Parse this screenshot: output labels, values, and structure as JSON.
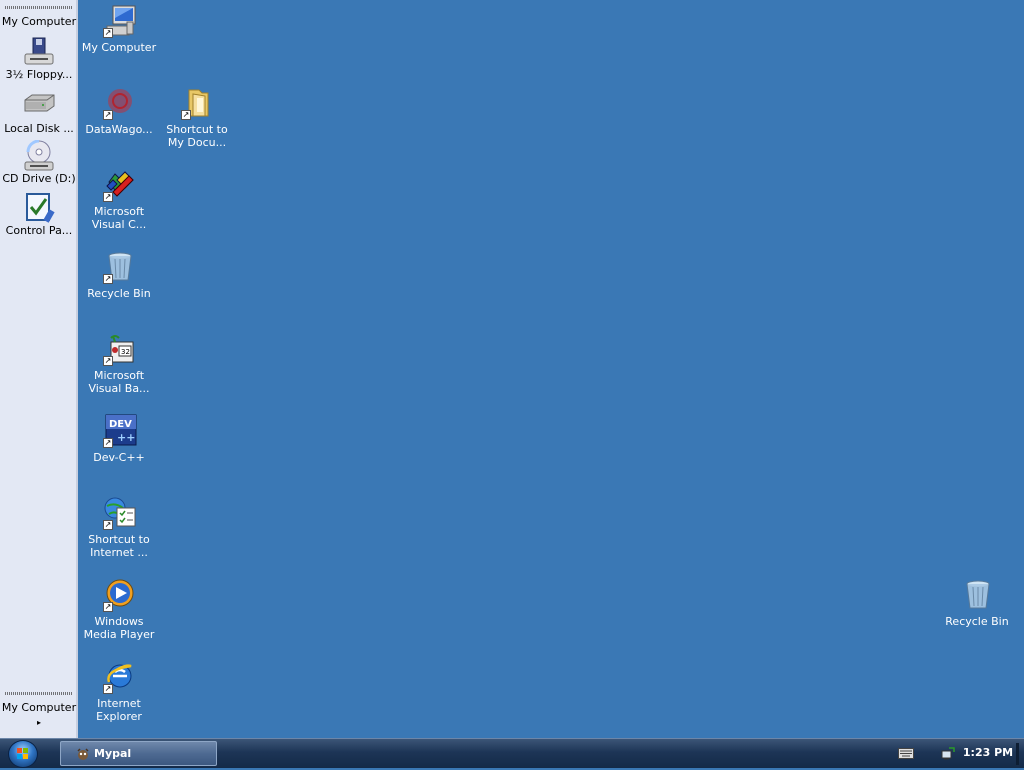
{
  "sidebar": {
    "title": "My Computer",
    "items": [
      {
        "label": "3½ Floppy...",
        "icon": "floppy-drive-icon"
      },
      {
        "label": "Local Disk ...",
        "icon": "hard-disk-icon"
      },
      {
        "label": "CD Drive (D:)",
        "icon": "cd-drive-icon"
      },
      {
        "label": "Control Pa...",
        "icon": "control-panel-icon"
      }
    ],
    "bottom_label": "My Computer",
    "bottom_chevron": "▸"
  },
  "desktop_icons": [
    {
      "label": "My Computer",
      "icon": "my-computer-icon",
      "shortcut": true
    },
    {
      "label": "DataWago...",
      "icon": "datawagon-icon",
      "shortcut": true
    },
    {
      "label": "Shortcut to My Docu...",
      "icon": "folder-icon",
      "shortcut": true
    },
    {
      "label": "Microsoft Visual C...",
      "icon": "visual-c-icon",
      "shortcut": true
    },
    {
      "label": "Recycle Bin",
      "icon": "recycle-bin-icon",
      "shortcut": true
    },
    {
      "label": "Microsoft Visual Ba...",
      "icon": "visual-basic-icon",
      "shortcut": true
    },
    {
      "label": "Dev-C++",
      "icon": "dev-cpp-icon",
      "shortcut": true
    },
    {
      "label": "Shortcut to Internet ...",
      "icon": "internet-options-icon",
      "shortcut": true
    },
    {
      "label": "Windows Media Player",
      "icon": "media-player-icon",
      "shortcut": true
    },
    {
      "label": "Internet Explorer",
      "icon": "internet-explorer-icon",
      "shortcut": true
    },
    {
      "label": "Recycle Bin",
      "icon": "recycle-bin-icon",
      "shortcut": false
    }
  ],
  "taskbar": {
    "start_icon": "windows-start-icon",
    "task_button": {
      "label": "Mypal",
      "icon": "mypal-icon"
    },
    "tray": {
      "keyboard_icon": "keyboard-icon",
      "network_icon": "network-icon"
    },
    "clock": "1:23 PM"
  },
  "colors": {
    "desktop_background": "#3a78b5",
    "sidebar_background": "#e3e8f4",
    "taskbar": "#1d3556"
  }
}
